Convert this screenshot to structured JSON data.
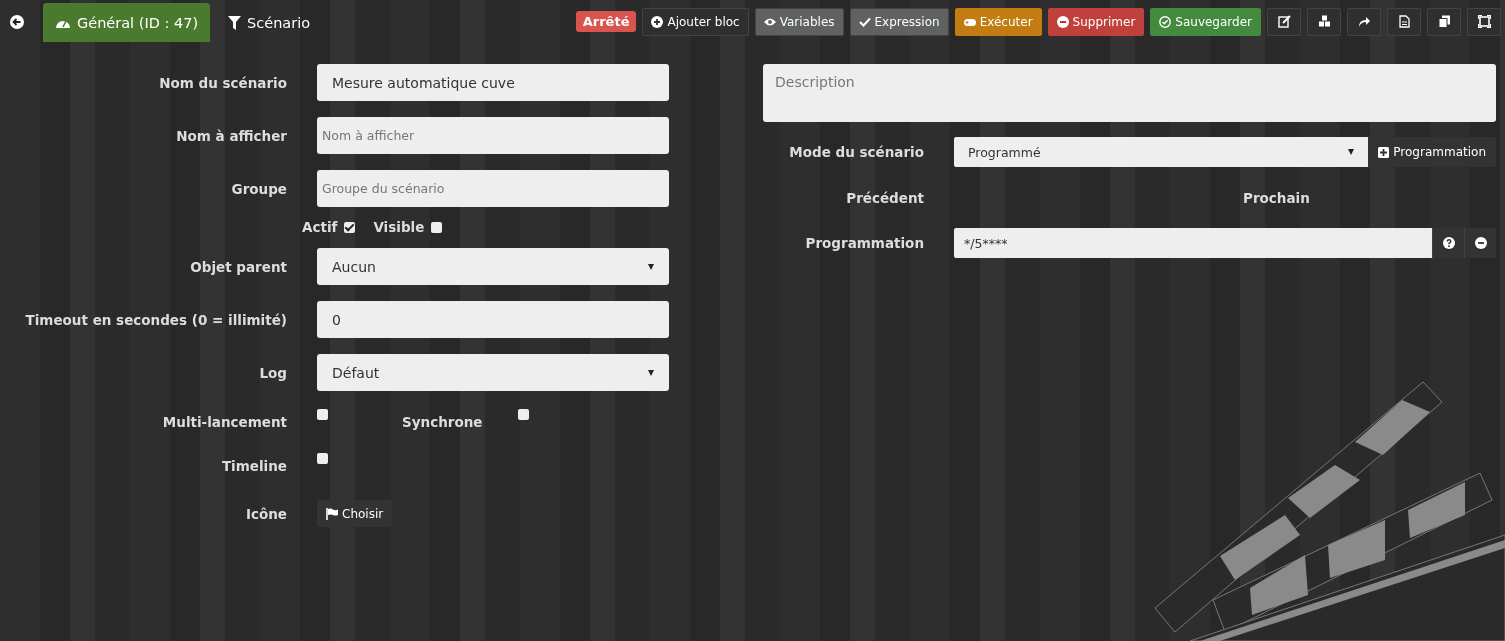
{
  "toolbar": {
    "tabs": [
      {
        "label": "Général (ID : 47)",
        "selected": true,
        "kind": "gauge"
      },
      {
        "label": "Scénario",
        "selected": false,
        "kind": "filter"
      }
    ],
    "status": "Arrêté",
    "actions": [
      {
        "label": "Ajouter bloc",
        "kind": "dark"
      },
      {
        "label": "Variables",
        "kind": "grey"
      },
      {
        "label": "Expression",
        "kind": "grey"
      },
      {
        "label": "Exécuter",
        "kind": "warning"
      },
      {
        "label": "Supprimer",
        "kind": "danger"
      },
      {
        "label": "Sauvegarder",
        "kind": "success"
      }
    ]
  },
  "left_form": [
    {
      "kind": "input",
      "label": "Nom du scénario",
      "value": "Mesure automatique cuve"
    },
    {
      "kind": "input",
      "label": "Nom à afficher",
      "placeholder": "Nom à afficher"
    },
    {
      "kind": "input",
      "label": "Groupe",
      "placeholder": "Groupe du scénario"
    },
    {
      "kind": "checks",
      "items": [
        {
          "label": "Actif",
          "checked": true
        },
        {
          "label": "Visible",
          "checked": false
        }
      ]
    },
    {
      "kind": "select",
      "label": "Objet parent",
      "value": "Aucun"
    },
    {
      "kind": "input",
      "label": "Timeout en secondes (0 = illimité)",
      "value": "0"
    },
    {
      "kind": "select",
      "label": "Log",
      "value": "Défaut"
    },
    {
      "kind": "check_pair",
      "items": [
        {
          "label": "Multi-lancement",
          "checked": false
        },
        {
          "label": "Synchrone",
          "checked": false
        }
      ]
    },
    {
      "kind": "check_pair",
      "items": [
        {
          "label": "Timeline",
          "checked": false
        }
      ]
    },
    {
      "kind": "button",
      "label": "Icône",
      "button": "Choisir"
    }
  ],
  "right_form": {
    "description": {
      "placeholder": "Description"
    },
    "mode": {
      "label": "Mode du scénario",
      "value": "Programmé",
      "button": "Programmation"
    },
    "previous": "Précédent",
    "next": "Prochain",
    "schedule": {
      "label": "Programmation",
      "value": "*/5****"
    }
  }
}
